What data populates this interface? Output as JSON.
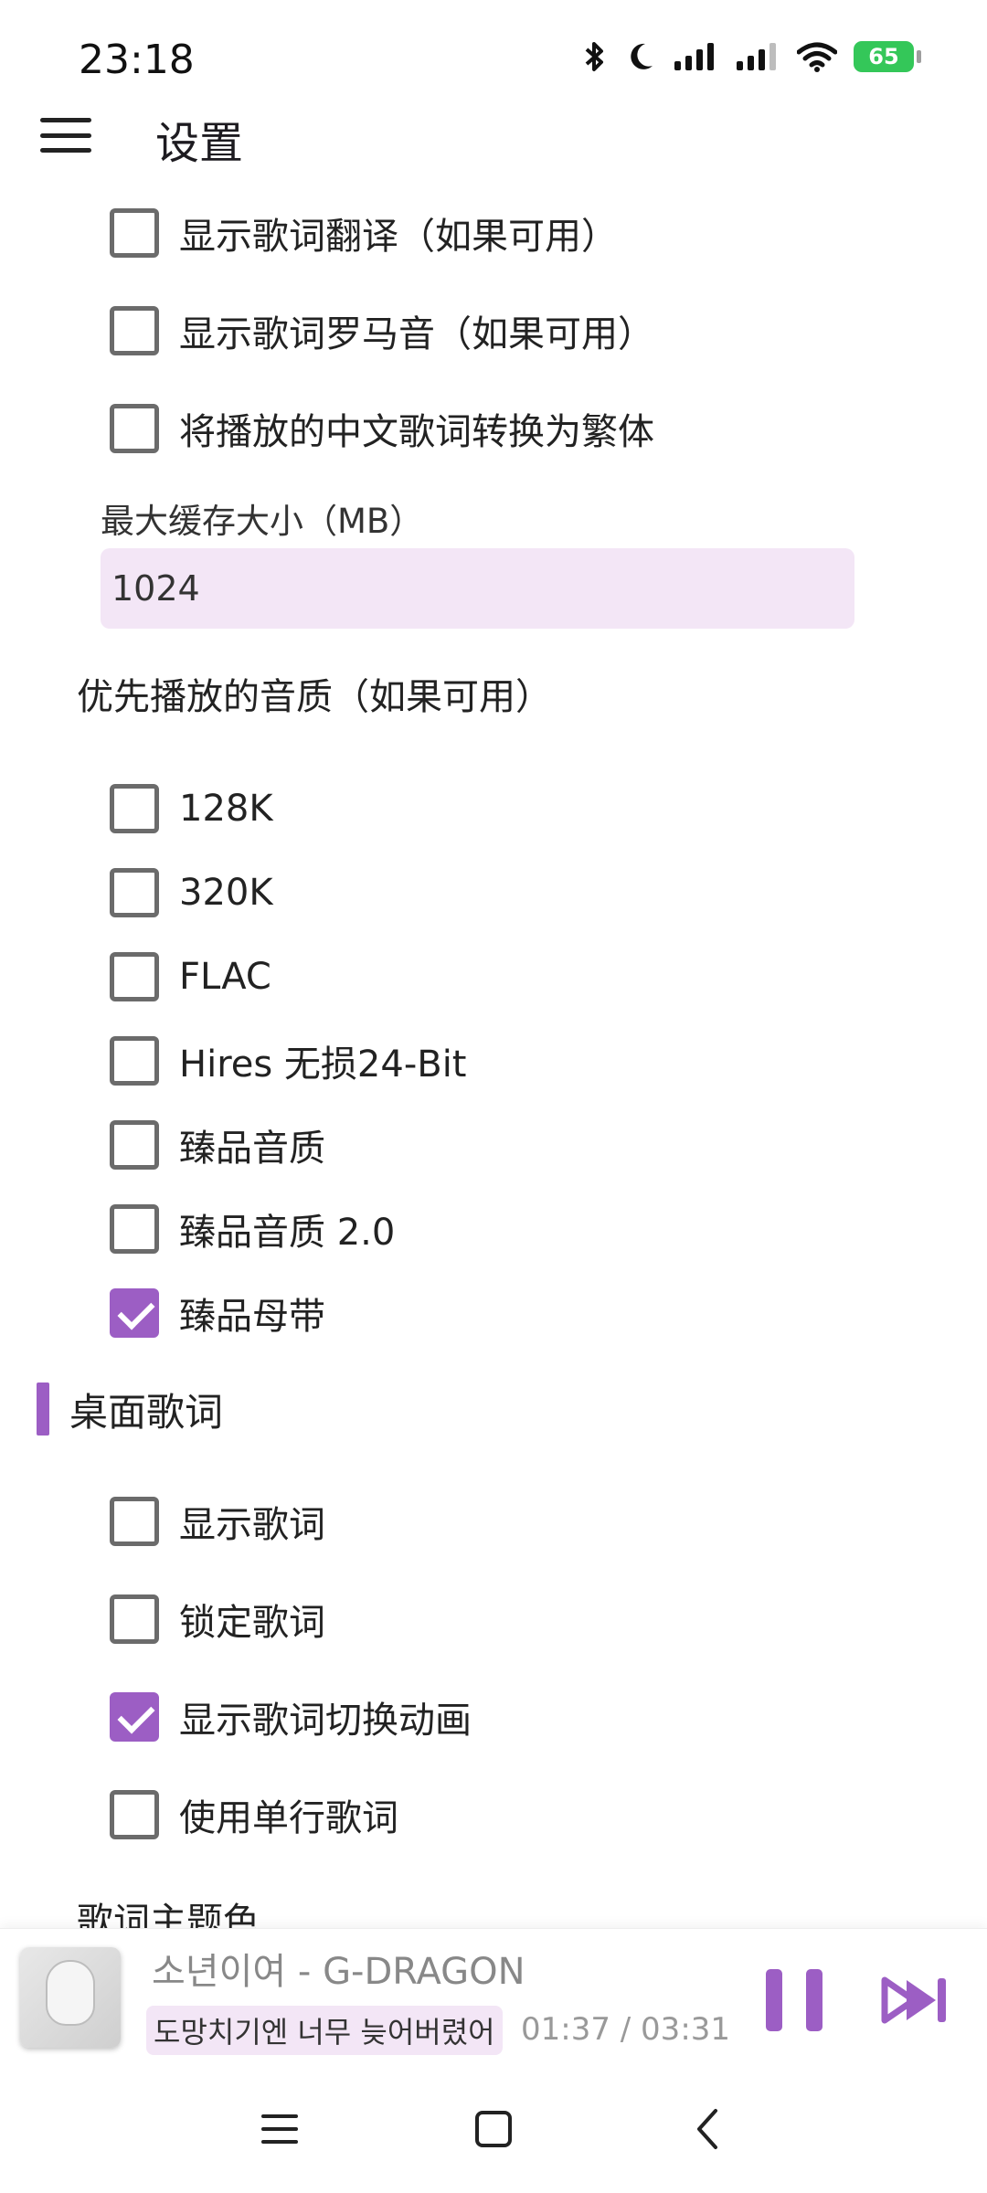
{
  "status_bar": {
    "time": "23:18",
    "battery": "65"
  },
  "app_bar": {
    "title": "设置"
  },
  "settings": {
    "lyric_options": [
      {
        "label": "显示歌词翻译（如果可用）",
        "checked": false
      },
      {
        "label": "显示歌词罗马音（如果可用）",
        "checked": false
      },
      {
        "label": "将播放的中文歌词转换为繁体",
        "checked": false
      }
    ],
    "cache": {
      "label": "最大缓存大小（MB）",
      "value": "1024"
    },
    "quality": {
      "title": "优先播放的音质（如果可用）",
      "options": [
        {
          "label": "128K",
          "checked": false
        },
        {
          "label": "320K",
          "checked": false
        },
        {
          "label": "FLAC",
          "checked": false
        },
        {
          "label": "Hires 无损24-Bit",
          "checked": false
        },
        {
          "label": "臻品音质",
          "checked": false
        },
        {
          "label": "臻品音质 2.0",
          "checked": false
        },
        {
          "label": "臻品母带",
          "checked": true
        }
      ]
    },
    "desktop_lyrics": {
      "title": "桌面歌词",
      "options": [
        {
          "label": "显示歌词",
          "checked": false
        },
        {
          "label": "锁定歌词",
          "checked": false
        },
        {
          "label": "显示歌词切换动画",
          "checked": true
        },
        {
          "label": "使用单行歌词",
          "checked": false
        }
      ],
      "theme_color_label": "歌词主题色"
    }
  },
  "player": {
    "title": "소년이여 - G-DRAGON",
    "lyric": "도망치기엔 너무 늦어버렸어",
    "time": "01:37 / 03:31"
  },
  "colors": {
    "accent": "#9c5ec4",
    "field_bg": "#f3e6f6"
  },
  "icons": {
    "status": [
      "bluetooth-icon",
      "moon-icon",
      "signal-icon",
      "signal-icon",
      "wifi-icon",
      "battery-icon"
    ],
    "nav": [
      "recents-icon",
      "home-icon",
      "back-icon"
    ],
    "player": [
      "pause-icon",
      "skip-next-icon"
    ]
  }
}
